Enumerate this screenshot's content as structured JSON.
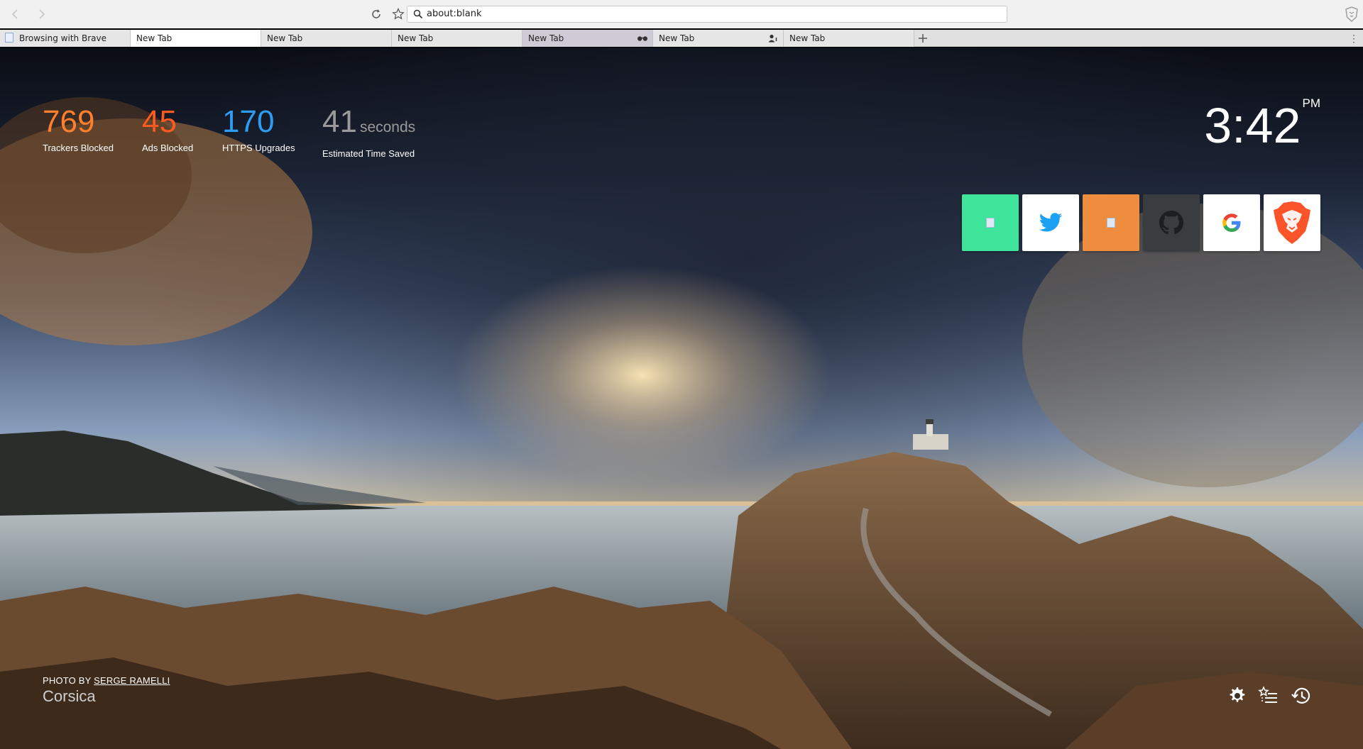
{
  "browser": {
    "back_icon": "chevron-left-icon",
    "forward_icon": "chevron-right-icon",
    "address": "about:blank",
    "tabs": [
      {
        "label": "Browsing with Brave",
        "state": "normal"
      },
      {
        "label": "New Tab",
        "state": "active"
      },
      {
        "label": "New Tab",
        "state": "normal"
      },
      {
        "label": "New Tab",
        "state": "normal"
      },
      {
        "label": "New Tab",
        "state": "private",
        "badge": "private-glasses-icon"
      },
      {
        "label": "New Tab",
        "state": "normal",
        "badge": "session-person-icon"
      },
      {
        "label": "New Tab",
        "state": "normal"
      }
    ],
    "menu_glyph": "⋮"
  },
  "stats": [
    {
      "value": "769",
      "unit": "",
      "label": "Trackers Blocked",
      "color": "#fe7f2d"
    },
    {
      "value": "45",
      "unit": "",
      "label": "Ads Blocked",
      "color": "#ff5a1f"
    },
    {
      "value": "170",
      "unit": "",
      "label": "HTTPS Upgrades",
      "color": "#2e9cf3"
    },
    {
      "value": "41",
      "unit": "seconds",
      "label": "Estimated Time Saved",
      "color": "#9a9a9a"
    }
  ],
  "clock": {
    "time": "3:42",
    "period": "PM"
  },
  "top_sites": [
    {
      "name": "site-tile-green",
      "bg": "#3ee49a",
      "icon": "page-icon"
    },
    {
      "name": "site-tile-twitter",
      "bg": "#ffffff",
      "icon": "twitter-icon"
    },
    {
      "name": "site-tile-orange",
      "bg": "#ef8d3f",
      "icon": "page-icon"
    },
    {
      "name": "site-tile-github",
      "bg": "#3a3d40",
      "icon": "github-icon"
    },
    {
      "name": "site-tile-google",
      "bg": "#ffffff",
      "icon": "google-icon"
    },
    {
      "name": "site-tile-brave",
      "bg": "#ffffff",
      "icon": "brave-lion-icon"
    }
  ],
  "photo": {
    "prefix": "PHOTO BY ",
    "author": "SERGE RAMELLI",
    "location": "Corsica"
  },
  "footer_icons": [
    "gear-icon",
    "bookmarks-icon",
    "history-icon"
  ]
}
